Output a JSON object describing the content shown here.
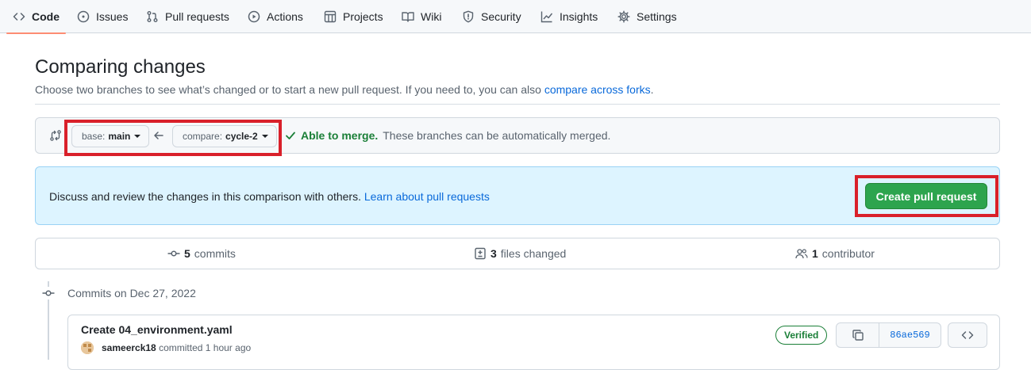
{
  "nav": {
    "items": [
      {
        "label": "Code",
        "icon": "code-icon",
        "active": true
      },
      {
        "label": "Issues",
        "icon": "issue-icon"
      },
      {
        "label": "Pull requests",
        "icon": "pull-request-icon"
      },
      {
        "label": "Actions",
        "icon": "play-icon"
      },
      {
        "label": "Projects",
        "icon": "table-icon"
      },
      {
        "label": "Wiki",
        "icon": "book-icon"
      },
      {
        "label": "Security",
        "icon": "shield-icon"
      },
      {
        "label": "Insights",
        "icon": "graph-icon"
      },
      {
        "label": "Settings",
        "icon": "gear-icon"
      }
    ]
  },
  "header": {
    "title": "Comparing changes",
    "subtitle": "Choose two branches to see what’s changed or to start a new pull request. If you need to, you can also ",
    "subtitle_link": "compare across forks",
    "subtitle_end": "."
  },
  "range": {
    "base_prefix": "base:",
    "base_branch": "main",
    "compare_prefix": "compare:",
    "compare_branch": "cycle-2",
    "merge_ok": "Able to merge.",
    "merge_text": "These branches can be automatically merged."
  },
  "blankslate": {
    "text": "Discuss and review the changes in this comparison with others. ",
    "link": "Learn about pull requests",
    "button": "Create pull request"
  },
  "summary": {
    "commits_count": "5",
    "commits_label": "commits",
    "files_count": "3",
    "files_label": "files changed",
    "contributors_count": "1",
    "contributors_label": "contributor"
  },
  "timeline": {
    "date_heading": "Commits on Dec 27, 2022",
    "commits": [
      {
        "title": "Create 04_environment.yaml",
        "author": "sameerck18",
        "action": "committed",
        "time": "1 hour ago",
        "badge": "Verified",
        "sha": "86ae569"
      }
    ]
  },
  "colors": {
    "accent": "#0969da",
    "success": "#1a7f37",
    "primary_button": "#2da44e",
    "highlight_box": "#d9202a",
    "active_tab": "#fd8c73"
  }
}
